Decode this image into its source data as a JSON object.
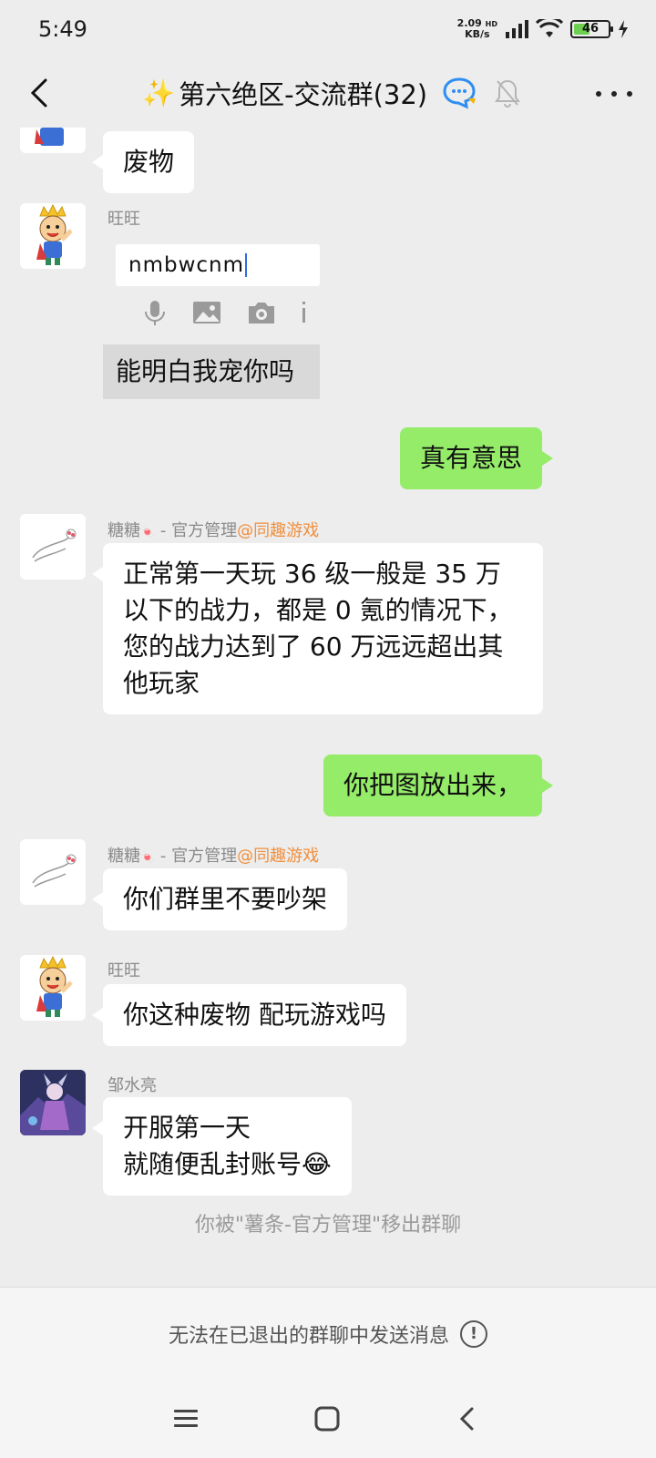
{
  "status": {
    "time": "5:49",
    "net_speed_value": "2.09",
    "net_speed_unit": "KB/s",
    "net_badge": "HD",
    "battery": "46",
    "battery_level_percent": 46
  },
  "header": {
    "sparkle": "✨",
    "title": "第六绝区-交流群(32)",
    "icons": [
      "chat-bubble-icon",
      "mute-bell-icon",
      "more-icon"
    ]
  },
  "messages": {
    "m1": {
      "text": "废物"
    },
    "m2": {
      "sender": "旺旺",
      "screenshot_input": "nmbwcnm",
      "screenshot_bubble": "能明白我宠你吗"
    },
    "m3": {
      "text": "真有意思"
    },
    "m4": {
      "sender_name": "糖糖",
      "sender_role": " - 官方管理",
      "sender_tag": "@同趣游戏",
      "text": "正常第一天玩 36 级一般是 35 万以下的战力，都是 0 氪的情况下，您的战力达到了 60 万远远超出其他玩家"
    },
    "m5": {
      "text": "你把图放出来，"
    },
    "m6": {
      "sender_name": "糖糖",
      "sender_role": " - 官方管理",
      "sender_tag": "@同趣游戏",
      "text": "你们群里不要吵架"
    },
    "m7": {
      "sender": "旺旺",
      "text": "你这种废物 配玩游戏吗"
    },
    "m8": {
      "sender": "邹水亮",
      "line1": "开服第一天",
      "line2": "就随便乱封账号",
      "emoji": "😂"
    },
    "system": "你被\"薯条-官方管理\"移出群聊"
  },
  "footer": {
    "text": "无法在已退出的群聊中发送消息",
    "info_icon": "!"
  },
  "colors": {
    "background": "#ededed",
    "bubble_self": "#95ec69",
    "bubble_other": "#ffffff",
    "admin_tag": "#f08f3d"
  }
}
